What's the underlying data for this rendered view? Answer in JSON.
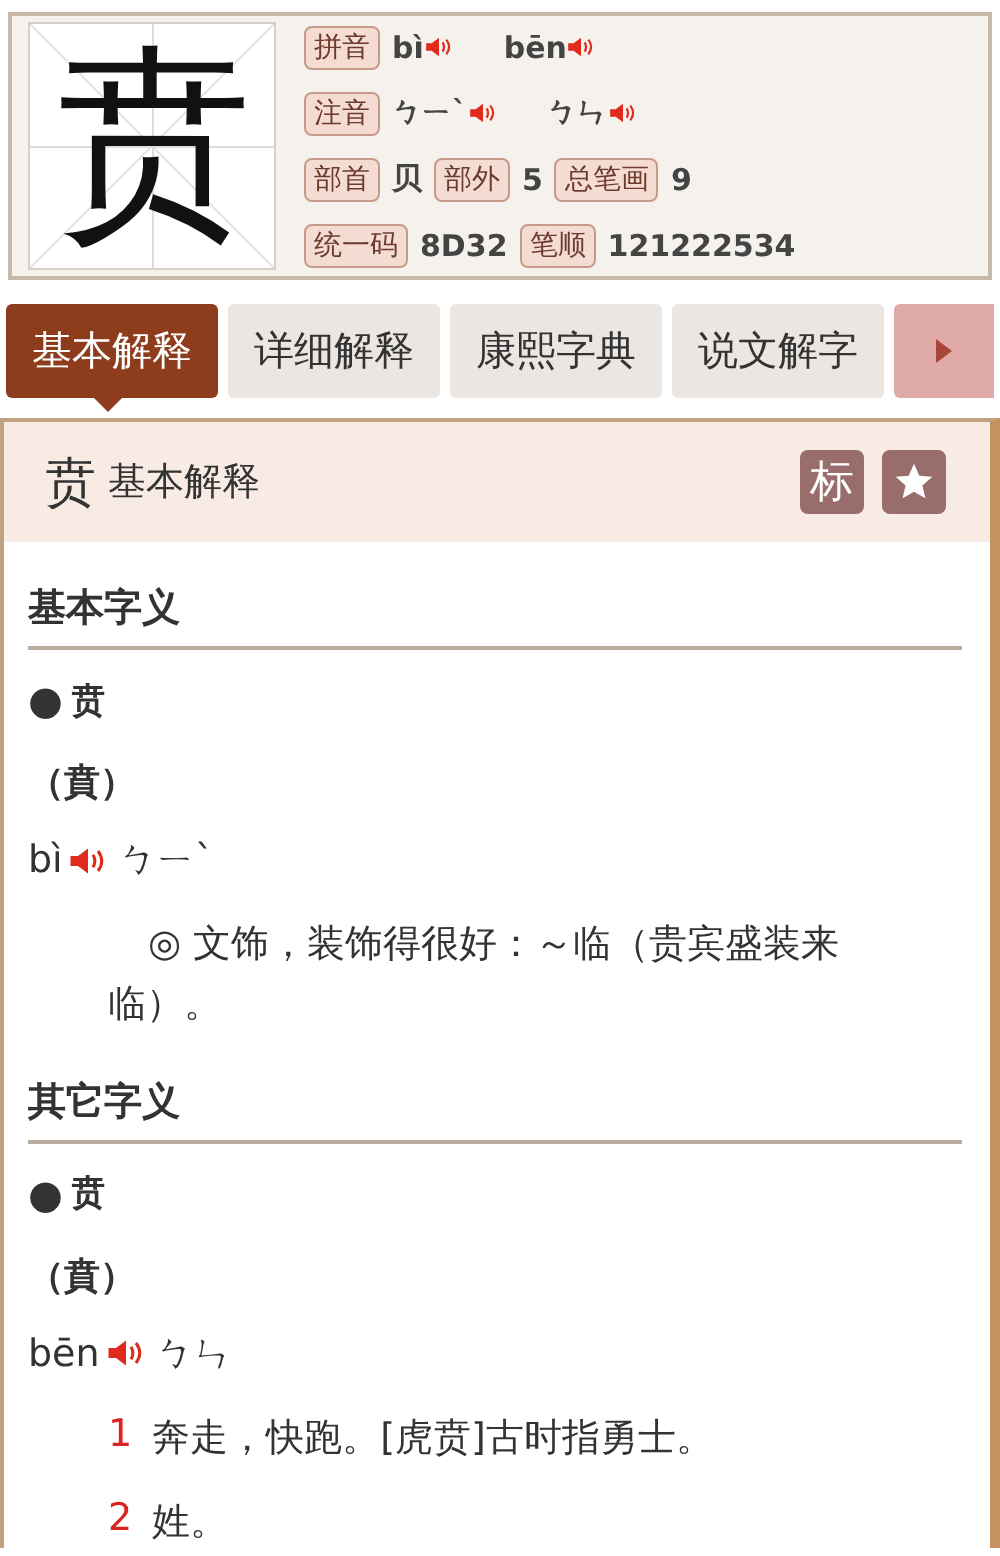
{
  "character": {
    "glyph": "贲"
  },
  "info_rows": [
    {
      "items": [
        {
          "kind": "label",
          "text": "拼音"
        },
        {
          "kind": "audio",
          "text": "bì"
        },
        {
          "kind": "audio",
          "text": "bēn"
        }
      ]
    },
    {
      "items": [
        {
          "kind": "label",
          "text": "注音"
        },
        {
          "kind": "audio",
          "text": "ㄅㄧˋ"
        },
        {
          "kind": "audio",
          "text": "ㄅㄣ"
        }
      ]
    },
    {
      "items": [
        {
          "kind": "label",
          "text": "部首"
        },
        {
          "kind": "value",
          "text": "贝"
        },
        {
          "kind": "label",
          "text": "部外"
        },
        {
          "kind": "value",
          "text": "5"
        },
        {
          "kind": "label",
          "text": "总笔画"
        },
        {
          "kind": "value",
          "text": "9"
        }
      ]
    },
    {
      "items": [
        {
          "kind": "label",
          "text": "统一码"
        },
        {
          "kind": "value",
          "text": "8D32"
        },
        {
          "kind": "label",
          "text": "笔顺"
        },
        {
          "kind": "value",
          "text": "121222534"
        }
      ]
    }
  ],
  "tabs": [
    {
      "label": "基本解释",
      "selected": true
    },
    {
      "label": "详细解释",
      "selected": false
    },
    {
      "label": "康熙字典",
      "selected": false
    },
    {
      "label": "说文解字",
      "selected": false
    }
  ],
  "panel": {
    "glyph": "贲",
    "title": "基本解释",
    "actions": [
      {
        "kind": "text",
        "label": "标"
      },
      {
        "kind": "star"
      }
    ]
  },
  "sections": [
    {
      "heading": "基本字义",
      "entries": [
        {
          "bullet": "●",
          "char": "贲",
          "traditional": "（賁）",
          "pinyin": "bì",
          "zhuyin": "ㄅㄧˋ",
          "definitions": [
            {
              "kind": "symbol",
              "marker": "◎",
              "text": "文饰，装饰得很好：～临（贵宾盛装来临）。"
            }
          ]
        }
      ]
    },
    {
      "heading": "其它字义",
      "entries": [
        {
          "bullet": "●",
          "char": "贲",
          "traditional": "（賁）",
          "pinyin": "bēn",
          "zhuyin": "ㄅㄣ",
          "definitions": [
            {
              "kind": "numbered",
              "marker": "1",
              "text": "奔走，快跑。[虎贲]古时指勇士。"
            },
            {
              "kind": "numbered",
              "marker": "2",
              "text": "姓。"
            }
          ]
        }
      ]
    }
  ]
}
